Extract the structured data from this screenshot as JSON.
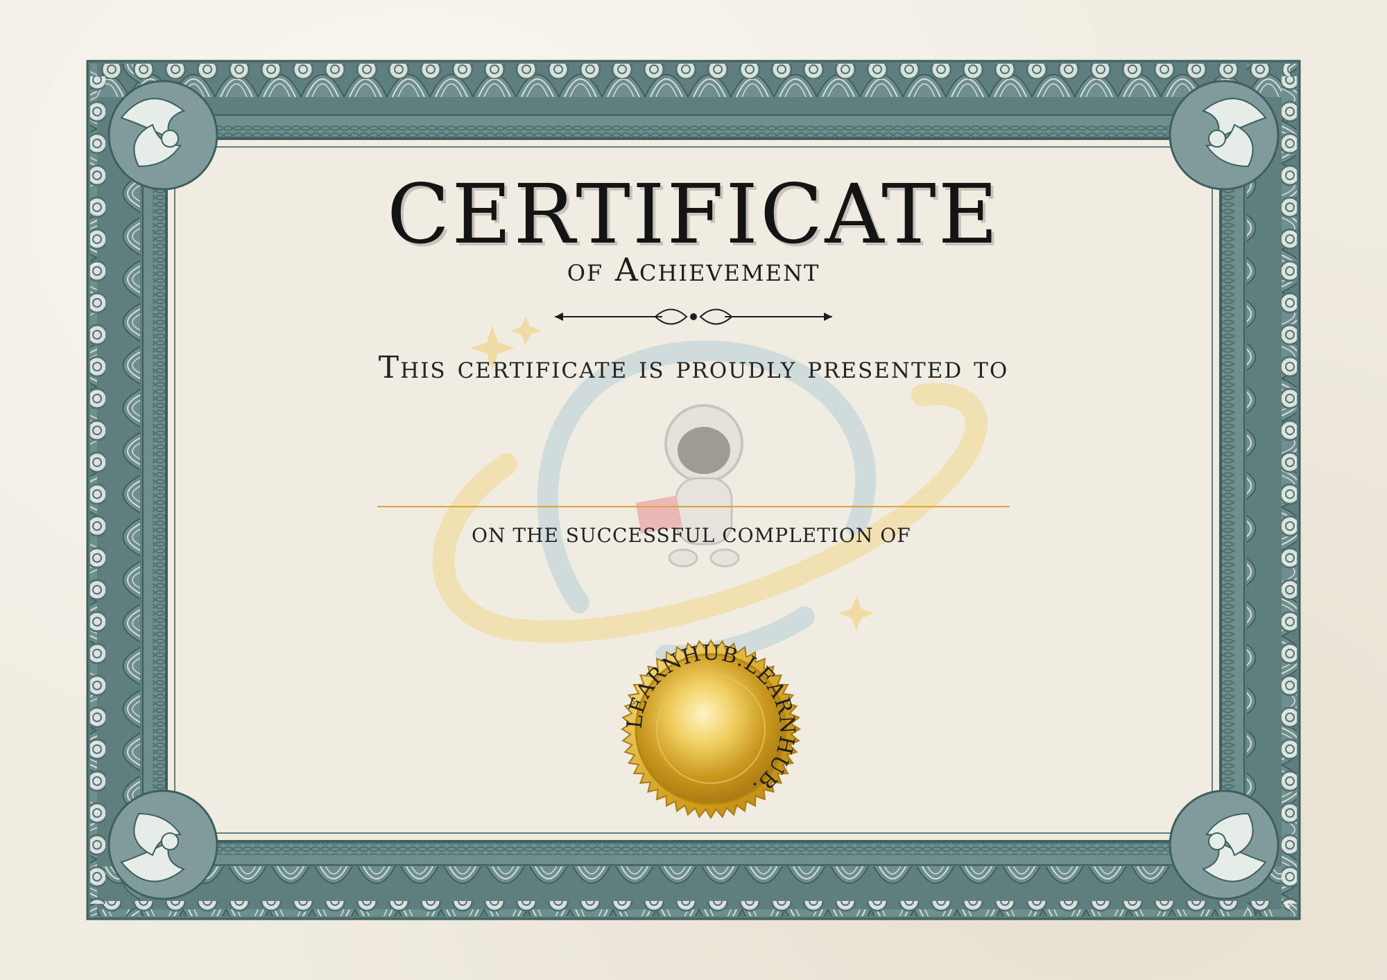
{
  "certificate": {
    "title": "CERTIFICATE",
    "subtitle": "of Achievement",
    "presented_text": "This certificate is proudly presented to",
    "completion_text": "ON THE SUCCESSFUL COMPLETION OF"
  },
  "seal": {
    "text": "LEARNHUB.LEARNHUB.",
    "color_gold": "#d9ad3a"
  },
  "colors": {
    "border": "#5f7f7f",
    "paper": "#f1ece1",
    "line": "#d9a440"
  }
}
